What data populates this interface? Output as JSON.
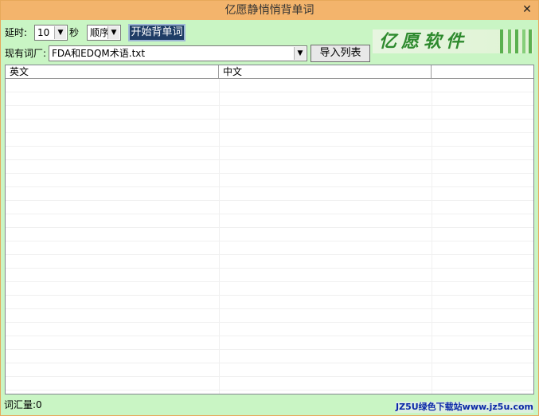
{
  "window": {
    "title": "亿愿静悄悄背单词",
    "close_glyph": "✕"
  },
  "toolbar": {
    "delay_label": "延时:",
    "delay_value": "10",
    "delay_unit": "秒",
    "order_value": "顺序",
    "start_button": "开始背单词",
    "wordlist_label": "现有词厂:",
    "wordlist_value": "FDA和EDQM术语.txt",
    "import_button": "导入列表"
  },
  "logo": {
    "text": "亿愿软件"
  },
  "list": {
    "columns": [
      "英文",
      "中文",
      ""
    ]
  },
  "status": {
    "count_label": "词汇量:0"
  },
  "watermark": {
    "text": "JZ5U绿色下载站www.jz5u.com"
  }
}
